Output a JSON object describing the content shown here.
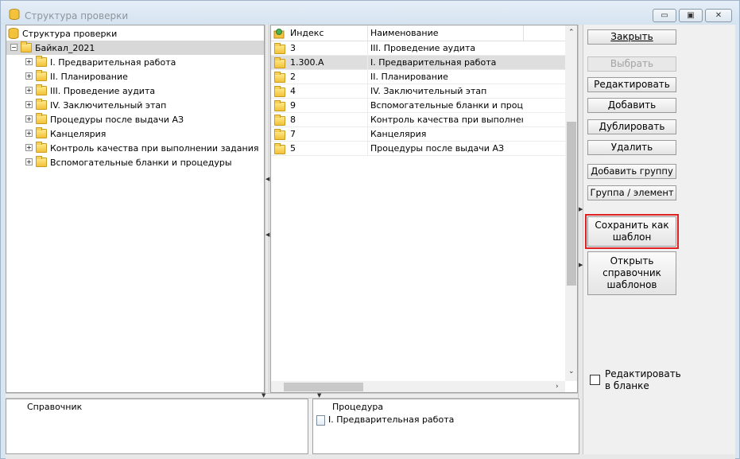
{
  "window": {
    "title": "Структура проверки",
    "minimize_glyph": "▭",
    "maximize_glyph": "▣",
    "close_glyph": "✕"
  },
  "tree": {
    "header": "Структура проверки",
    "root": "Байкал_2021",
    "items": [
      "I. Предварительная работа",
      "II. Планирование",
      "III. Проведение аудита",
      "IV. Заключительный этап",
      "Процедуры после выдачи АЗ",
      "Канцелярия",
      "Контроль качества при выполнении задания",
      "Вспомогательные бланки  и процедуры"
    ]
  },
  "grid": {
    "columns": [
      "Индекс",
      "Наименование"
    ],
    "rows": [
      {
        "index": "3",
        "name": "III. Проведение аудита"
      },
      {
        "index": "1.300.A",
        "name": "I. Предварительная работа"
      },
      {
        "index": "2",
        "name": "II. Планирование"
      },
      {
        "index": "4",
        "name": "IV. Заключительный этап"
      },
      {
        "index": "9",
        "name": "Вспомогательные бланки  и проце..."
      },
      {
        "index": "8",
        "name": "Контроль качества при выполнени..."
      },
      {
        "index": "7",
        "name": "Канцелярия"
      },
      {
        "index": "5",
        "name": "Процедуры после выдачи АЗ"
      }
    ],
    "selected_row": 1
  },
  "buttons": {
    "close": "Закрыть",
    "select": "Выбрать",
    "edit": "Редактировать",
    "add": "Добавить",
    "duplicate": "Дублировать",
    "delete": "Удалить",
    "add_group": "Добавить группу",
    "group_element": "Группа / элемент",
    "save_template_1": "Сохранить как",
    "save_template_2": "шаблон",
    "open_templates_1": "Открыть",
    "open_templates_2": "справочник",
    "open_templates_3": "шаблонов"
  },
  "checkbox": {
    "label_1": "Редактировать",
    "label_2": "в бланке",
    "checked": false
  },
  "bottom": {
    "left_header": "Справочник",
    "right_header": "Процедура",
    "right_item": "I. Предварительная работа"
  },
  "colors": {
    "highlight_border": "#e02020",
    "selection": "#dedede",
    "folder": "#f2c23a"
  }
}
